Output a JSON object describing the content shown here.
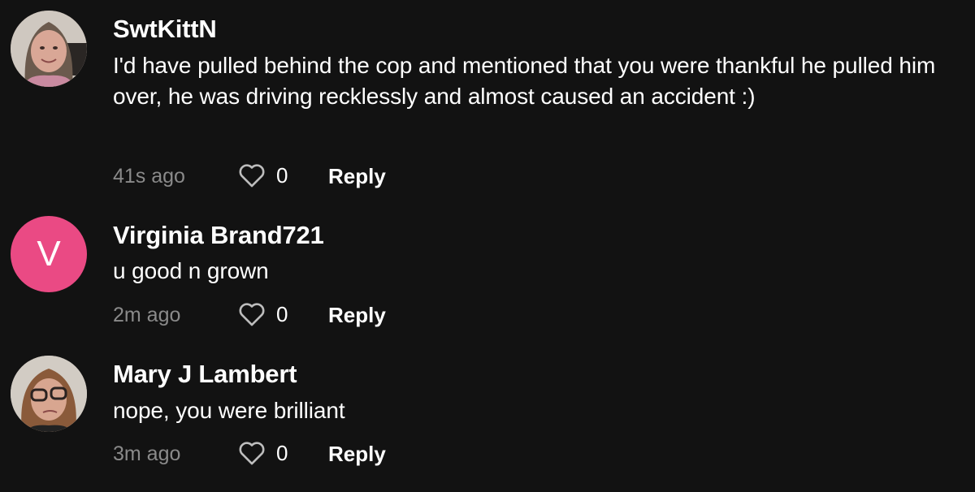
{
  "colors": {
    "background": "#121212",
    "time_text": "#8a8a8a",
    "avatar_letter_bg": "#ea4a84"
  },
  "comments": [
    {
      "username": "SwtKittN",
      "avatar": {
        "type": "photo",
        "icon": "user-photo"
      },
      "text": "I'd have pulled behind the cop and mentioned that you were thankful he pulled him over, he was driving recklessly and almost caused an accident :)",
      "time": "41s ago",
      "likes": "0",
      "like_icon": "heart-outline-icon",
      "reply_label": "Reply"
    },
    {
      "username": "Virginia Brand721",
      "avatar": {
        "type": "letter",
        "letter": "V"
      },
      "text": "u good n grown",
      "time": "2m ago",
      "likes": "0",
      "like_icon": "heart-outline-icon",
      "reply_label": "Reply"
    },
    {
      "username": "Mary J Lambert",
      "avatar": {
        "type": "photo",
        "icon": "user-photo"
      },
      "text": "nope, you were brilliant",
      "time": "3m ago",
      "likes": "0",
      "like_icon": "heart-outline-icon",
      "reply_label": "Reply"
    }
  ]
}
